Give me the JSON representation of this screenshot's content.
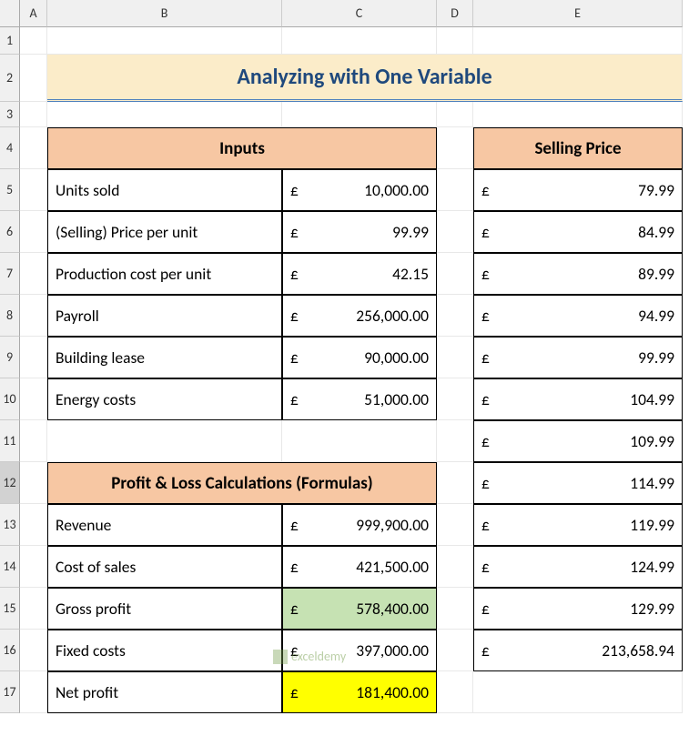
{
  "columns": [
    "A",
    "B",
    "C",
    "D",
    "E"
  ],
  "rows": [
    "1",
    "2",
    "3",
    "4",
    "5",
    "6",
    "7",
    "8",
    "9",
    "10",
    "11",
    "12",
    "13",
    "14",
    "15",
    "16",
    "17"
  ],
  "selectedRow": "12",
  "title": "Analyzing with One Variable",
  "inputsHeader": "Inputs",
  "sellingHeader": "Selling Price",
  "plHeader": "Profit & Loss Calculations (Formulas)",
  "currency": "£",
  "inputs": [
    {
      "label": "Units sold",
      "value": "10,000.00"
    },
    {
      "label": "(Selling) Price per unit",
      "value": "99.99"
    },
    {
      "label": "Production cost per unit",
      "value": "42.15"
    },
    {
      "label": "Payroll",
      "value": "256,000.00"
    },
    {
      "label": "Building lease",
      "value": "90,000.00"
    },
    {
      "label": "Energy costs",
      "value": "51,000.00"
    }
  ],
  "pl": [
    {
      "label": "Revenue",
      "value": "999,900.00"
    },
    {
      "label": "Cost of sales",
      "value": "421,500.00"
    },
    {
      "label": "Gross profit",
      "value": "578,400.00",
      "class": "green"
    },
    {
      "label": "Fixed costs",
      "value": "397,000.00"
    },
    {
      "label": "Net profit",
      "value": "181,400.00",
      "class": "yellow"
    }
  ],
  "selling": [
    "79.99",
    "84.99",
    "89.99",
    "94.99",
    "99.99",
    "104.99",
    "109.99",
    "114.99",
    "119.99",
    "124.99",
    "129.99",
    "213,658.94"
  ],
  "watermark": "exceldemy"
}
